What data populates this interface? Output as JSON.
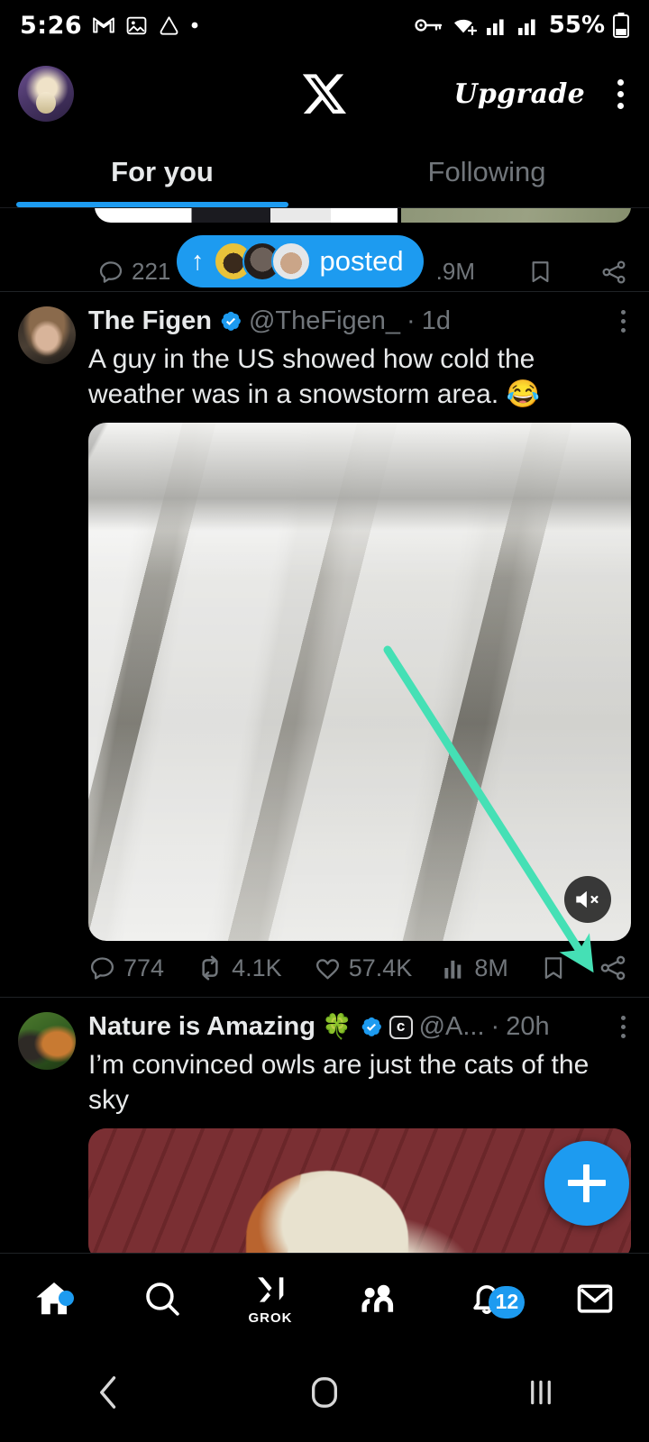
{
  "colors": {
    "accent_blue": "#1d9bf0",
    "background": "#000000",
    "text_primary": "#e7e9ea",
    "text_secondary": "#71767b",
    "annotation_arrow": "#45e0b5",
    "verified_badge": "#1d9bf0"
  },
  "statusbar": {
    "time": "5:26",
    "battery_percent": "55%",
    "left_icons": [
      "gmail-icon",
      "photos-icon",
      "drive-icon",
      "dot-icon"
    ],
    "right_icons": [
      "vpn-key-icon",
      "wifi-icon",
      "signal-icon",
      "signal-icon-2",
      "battery-icon"
    ]
  },
  "header": {
    "avatar": "profile-avatar",
    "logo": "x-logo",
    "upgrade_label": "Upgrade",
    "menu": "kebab-menu-icon"
  },
  "tabs": [
    {
      "label": "For you",
      "active": true
    },
    {
      "label": "Following",
      "active": false
    }
  ],
  "clipped_post": {
    "replies": "221",
    "views": ".9M",
    "bookmark": "bookmark-icon",
    "share": "share-icon"
  },
  "posted_pill": {
    "arrow": "↑",
    "label": "posted",
    "avatar_count": 3
  },
  "posts": [
    {
      "avatar": "thefigen-avatar",
      "name": "The Figen",
      "verified": true,
      "affiliate_badge": null,
      "emoji_after_name": "",
      "handle": "@TheFigen_",
      "separator": "·",
      "time": "1d",
      "text": "A guy in the US showed how cold the weather was in a snowstorm area. 😂",
      "media": "snowstorm-road-video",
      "muted": true,
      "actions": {
        "replies": "774",
        "reposts": "4.1K",
        "likes": "57.4K",
        "views": "8M",
        "bookmark": "bookmark-icon",
        "share": "share-icon"
      }
    },
    {
      "avatar": "nature-is-amazing-avatar",
      "name": "Nature is Amazing",
      "emoji_after_name": "🍀",
      "verified": true,
      "affiliate_badge": "c",
      "handle": "@A...",
      "separator": "·",
      "time": "20h",
      "text": "I’m convinced owls are just the cats of the sky",
      "media": "owl-brick-wall-video"
    }
  ],
  "compose_fab": {
    "icon": "plus-icon",
    "label": "Post"
  },
  "bottom_nav": [
    {
      "name": "home",
      "icon": "home-icon",
      "active": true,
      "dot": true,
      "label": ""
    },
    {
      "name": "search",
      "icon": "search-icon",
      "active": false,
      "label": ""
    },
    {
      "name": "grok",
      "icon": "grok-icon",
      "active": false,
      "label": "GROK"
    },
    {
      "name": "communities",
      "icon": "communities-icon",
      "active": false,
      "label": ""
    },
    {
      "name": "notifications",
      "icon": "bell-icon",
      "active": false,
      "badge": "12",
      "label": ""
    },
    {
      "name": "messages",
      "icon": "envelope-icon",
      "active": false,
      "label": ""
    }
  ],
  "android_nav": [
    {
      "name": "back",
      "icon": "back-chevron-icon"
    },
    {
      "name": "home",
      "icon": "home-squircle-icon"
    },
    {
      "name": "recents",
      "icon": "recents-bars-icon"
    }
  ],
  "annotation": {
    "type": "arrow",
    "points_to": "share-icon",
    "color": "#45e0b5"
  }
}
